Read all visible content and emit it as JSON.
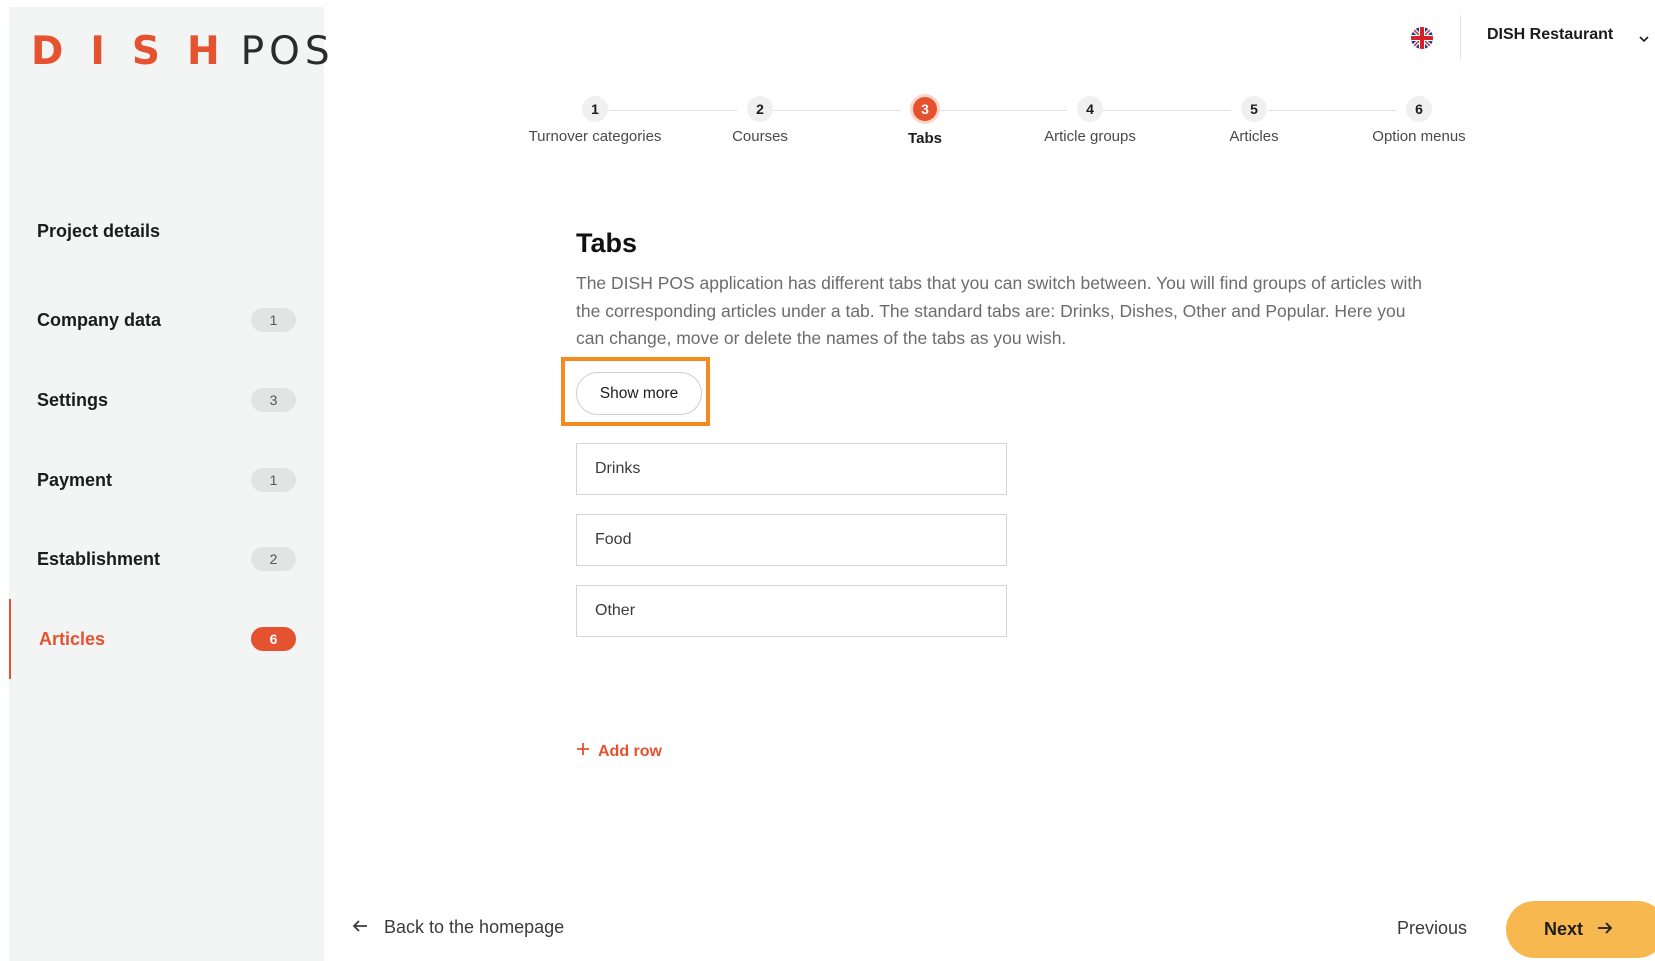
{
  "brand": {
    "logo_primary": "DISH",
    "logo_secondary": "POS",
    "accent_color": "#e5522f"
  },
  "header": {
    "language_icon": "uk-flag-icon",
    "restaurant_name": "DISH Restaurant"
  },
  "sidebar": {
    "items": [
      {
        "label": "Project details",
        "count": ""
      },
      {
        "label": "Company data",
        "count": "1"
      },
      {
        "label": "Settings",
        "count": "3"
      },
      {
        "label": "Payment",
        "count": "1"
      },
      {
        "label": "Establishment",
        "count": "2"
      },
      {
        "label": "Articles",
        "count": "6",
        "active": true
      }
    ]
  },
  "stepper": {
    "steps": [
      {
        "number": "1",
        "label": "Turnover categories"
      },
      {
        "number": "2",
        "label": "Courses"
      },
      {
        "number": "3",
        "label": "Tabs",
        "active": true
      },
      {
        "number": "4",
        "label": "Article groups"
      },
      {
        "number": "5",
        "label": "Articles"
      },
      {
        "number": "6",
        "label": "Option menus"
      }
    ]
  },
  "main": {
    "title": "Tabs",
    "description": "The DISH POS application has different tabs that you can switch between. You will find groups of articles with the corresponding articles under a tab. The standard tabs are: Drinks, Dishes, Other and Popular. Here you can change, move or delete the names of the tabs as you wish.",
    "show_more_label": "Show more",
    "tabs": [
      "Drinks",
      "Food",
      "Other"
    ],
    "add_row_label": "Add row"
  },
  "footer": {
    "back_label": "Back to the homepage",
    "previous_label": "Previous",
    "next_label": "Next"
  }
}
